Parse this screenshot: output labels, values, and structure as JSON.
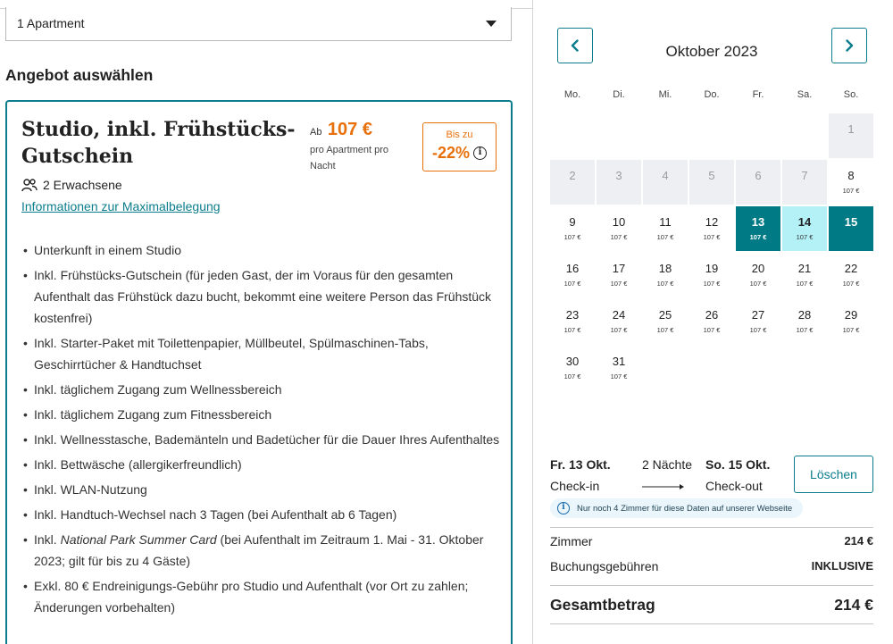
{
  "room_select": {
    "value": "1 Apartment"
  },
  "section_heading": "Angebot auswählen",
  "offer": {
    "title": "Studio, inkl. Frühstücks-Gutschein",
    "price_prefix": "Ab",
    "price": "107 €",
    "price_note": "pro Apartment pro Nacht",
    "discount_top": "Bis zu",
    "discount_value": "-22%",
    "guests": "2 Erwachsene",
    "max_occupancy_link": "Informationen zur Maximalbelegung",
    "features": [
      "Unterkunft in einem Studio",
      "Inkl. Frühstücks-Gutschein (für jeden Gast, der im Voraus für den gesamten Aufenthalt das Frühstück dazu bucht, bekommt eine weitere Person das Frühstück kostenfrei)",
      "Inkl. Starter-Paket mit Toilettenpapier, Müllbeutel, Spülmaschinen-Tabs, Geschirrtücher & Handtuchset",
      "Inkl. täglichem Zugang zum Wellnessbereich",
      "Inkl. täglichem Zugang zum Fitnessbereich",
      "Inkl. Wellnesstasche, Bademänteln und Badetücher für die Dauer Ihres Aufenthaltes",
      "Inkl. Bettwäsche (allergikerfreundlich)",
      "Inkl. WLAN-Nutzung",
      "Inkl. Handtuch-Wechsel nach 3 Tagen (bei Aufenthalt ab 6 Tagen)",
      {
        "prefix": "Inkl. ",
        "italic": "National Park Summer Card",
        "suffix": " (bei Aufenthalt im Zeitraum 1. Mai - 31. Oktober 2023; gilt für bis zu 4 Gäste)"
      },
      "Exkl. 80 € Endreinigungs-Gebühr pro Studio und Aufenthalt (vor Ort zu zahlen; Änderungen vorbehalten)"
    ]
  },
  "calendar": {
    "month": "Oktober 2023",
    "weekdays": [
      "Mo.",
      "Di.",
      "Mi.",
      "Do.",
      "Fr.",
      "Sa.",
      "So."
    ],
    "leading_blank_days": 6,
    "days": [
      {
        "d": "1",
        "state": "disabled"
      },
      {
        "d": "2",
        "state": "disabled"
      },
      {
        "d": "3",
        "state": "disabled"
      },
      {
        "d": "4",
        "state": "disabled"
      },
      {
        "d": "5",
        "state": "disabled"
      },
      {
        "d": "6",
        "state": "disabled"
      },
      {
        "d": "7",
        "state": "disabled"
      },
      {
        "d": "8",
        "price": "107 €"
      },
      {
        "d": "9",
        "price": "107 €"
      },
      {
        "d": "10",
        "price": "107 €"
      },
      {
        "d": "11",
        "price": "107 €"
      },
      {
        "d": "12",
        "price": "107 €"
      },
      {
        "d": "13",
        "price": "107 €",
        "state": "sel-start"
      },
      {
        "d": "14",
        "price": "107 €",
        "state": "sel-mid"
      },
      {
        "d": "15",
        "state": "sel-end"
      },
      {
        "d": "16",
        "price": "107 €"
      },
      {
        "d": "17",
        "price": "107 €"
      },
      {
        "d": "18",
        "price": "107 €"
      },
      {
        "d": "19",
        "price": "107 €"
      },
      {
        "d": "20",
        "price": "107 €"
      },
      {
        "d": "21",
        "price": "107 €"
      },
      {
        "d": "22",
        "price": "107 €"
      },
      {
        "d": "23",
        "price": "107 €"
      },
      {
        "d": "24",
        "price": "107 €"
      },
      {
        "d": "25",
        "price": "107 €"
      },
      {
        "d": "26",
        "price": "107 €"
      },
      {
        "d": "27",
        "price": "107 €"
      },
      {
        "d": "28",
        "price": "107 €"
      },
      {
        "d": "29",
        "price": "107 €"
      },
      {
        "d": "30",
        "price": "107 €"
      },
      {
        "d": "31",
        "price": "107 €"
      }
    ]
  },
  "summary": {
    "checkin_date": "Fr. 13 Okt.",
    "checkin_label": "Check-in",
    "nights": "2 Nächte",
    "checkout_date": "So. 15 Okt.",
    "checkout_label": "Check-out",
    "clear_label": "Löschen",
    "availability_notice": "Nur noch 4 Zimmer für diese Daten auf unserer Webseite",
    "room_label": "Zimmer",
    "room_amount": "214 €",
    "fees_label": "Buchungsgebühren",
    "fees_amount": "INKLUSIVE",
    "total_label": "Gesamtbetrag",
    "total_amount": "214 €"
  },
  "colors": {
    "accent": "#0b7d8c",
    "selected": "#007a85",
    "range": "#b4f1f7",
    "price": "#e8700a"
  },
  "icons": {
    "prev": "chevron-left-icon",
    "next": "chevron-right-icon",
    "guests": "people-icon",
    "info": "info-icon",
    "dropdown": "caret-down-icon"
  }
}
